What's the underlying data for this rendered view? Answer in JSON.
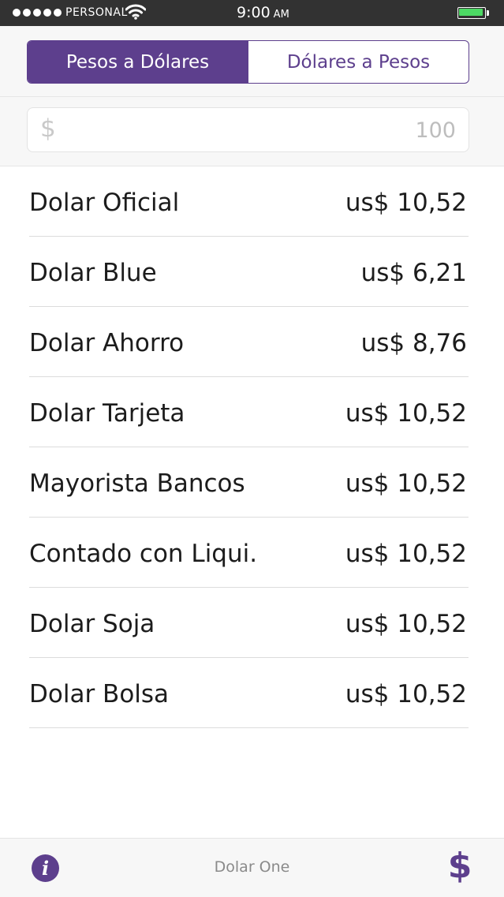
{
  "status_bar": {
    "carrier": "PERSONAL",
    "time": "9:00",
    "ampm": "AM",
    "icons": [
      "signal-dots-icon",
      "wifi-icon",
      "battery-icon"
    ]
  },
  "segmented": {
    "tabs": [
      {
        "label": "Pesos a Dólares",
        "active": true
      },
      {
        "label": "Dólares a Pesos",
        "active": false
      }
    ]
  },
  "amount": {
    "symbol": "$",
    "placeholder": "100"
  },
  "rates": [
    {
      "name": "Dolar Oficial",
      "value": "us$ 10,52"
    },
    {
      "name": "Dolar Blue",
      "value": "us$ 6,21"
    },
    {
      "name": "Dolar Ahorro",
      "value": "us$ 8,76"
    },
    {
      "name": "Dolar Tarjeta",
      "value": "us$ 10,52"
    },
    {
      "name": "Mayorista Bancos",
      "value": "us$ 10,52"
    },
    {
      "name": "Contado con Liqui.",
      "value": "us$ 10,52"
    },
    {
      "name": "Dolar Soja",
      "value": "us$ 10,52"
    },
    {
      "name": "Dolar Bolsa",
      "value": "us$ 10,52"
    }
  ],
  "bottom_bar": {
    "info_icon": "i",
    "title": "Dolar One",
    "dollar_icon": "$"
  },
  "colors": {
    "accent": "#5d3f8d",
    "status_bar_bg": "#323232",
    "battery": "#4cd964"
  }
}
